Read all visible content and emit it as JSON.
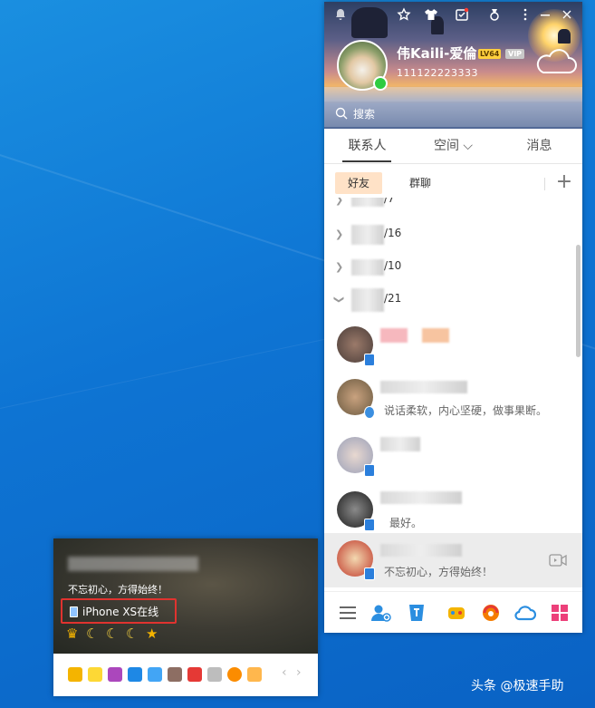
{
  "header": {
    "nickname": "伟Kaili-爱倫",
    "level_badge": "LV64",
    "vip_badge": "VIP",
    "qq_number": "111122223333",
    "search_placeholder": "搜索"
  },
  "tabs": [
    {
      "label": "联系人",
      "active": true
    },
    {
      "label": "空间 ⌵",
      "active": false
    },
    {
      "label": "消息",
      "active": false
    }
  ],
  "subtabs": [
    {
      "label": "好友",
      "active": true
    },
    {
      "label": "群聊",
      "active": false
    }
  ],
  "plus_label": "+",
  "groups": [
    {
      "date": "/7",
      "expanded": false
    },
    {
      "date": "/16",
      "expanded": false
    },
    {
      "date": "/10",
      "expanded": false
    },
    {
      "date": "/21",
      "expanded": true
    }
  ],
  "contacts": [
    {
      "signature": "",
      "device": "phone"
    },
    {
      "signature": "说话柔软，内心坚硬，做事果断。",
      "device": "star"
    },
    {
      "signature": "",
      "device": "phone"
    },
    {
      "signature": "最好。",
      "device": "phone"
    },
    {
      "signature": "不忘初心，方得始终！",
      "device": "phone",
      "selected": true
    }
  ],
  "card": {
    "signature": "不忘初心，方得始终！",
    "device_status": "iPhone XS在线",
    "level_glyphs": [
      "♛",
      "☾",
      "☾",
      "☾",
      "★"
    ]
  },
  "watermark": "头条 @极速手助",
  "colors": {
    "desktop": "#0e74d3",
    "highlight_box": "#e0332f",
    "online": "#2ecc40",
    "subtab_active": "#ffbe82"
  }
}
